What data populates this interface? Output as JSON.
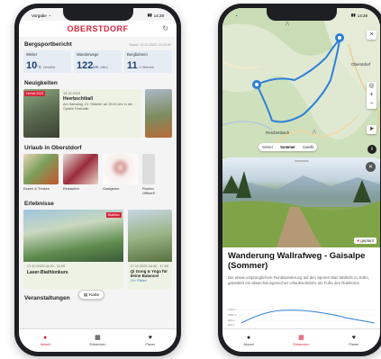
{
  "left": {
    "status_left": "Vorgabe",
    "status_right": "14:28",
    "brand": "OBERSTDORF",
    "refresh_icon": "refresh-icon",
    "report": {
      "title": "Bergsportbericht",
      "timestamp": "Stand: 13.10.2023 13:43:30",
      "cards": [
        {
          "label": "Wetter",
          "value": "10",
          "unit": "°C",
          "sub": "bewölkt"
        },
        {
          "label": "Wanderwege",
          "value": "122",
          "unit": "km",
          "sub": "offen"
        },
        {
          "label": "Bergbahnen",
          "value": "11",
          "unit": "",
          "sub": "in Betrieb"
        }
      ]
    },
    "news": {
      "title": "Neuigkeiten",
      "tag": "Herbst 2023",
      "date": "13.10.2023",
      "headline": "Heerbschtball",
      "text": "Am Samstag, 21. Oktober ab 19:00 Uhr in der Oybele Festhalle."
    },
    "urlaub": {
      "title": "Urlaub in Oberstdorf",
      "items": [
        "Essen & Trinken",
        "Einkaufen",
        "Gastgeber",
        "Routen"
      ],
      "peek_sub": "OfflineS"
    },
    "events": {
      "title": "Erlebnisse",
      "card": {
        "tag": "Biathlon",
        "date": "17.10.2023 10:00 - 11:00",
        "title": "Laser-Biathlonkurs"
      },
      "peek": {
        "date": "17.10.2023 16:00 - 17:00",
        "title": "Qi Gong & Yoga für deine Balance!",
        "link": "10+ Plätze"
      }
    },
    "next_section": "Veranstaltungen",
    "karte": "Karte",
    "tabs": [
      {
        "label": "Aktuell",
        "icon": "home-icon",
        "glyph": "●"
      },
      {
        "label": "Entdecken",
        "icon": "grid-icon",
        "glyph": "▦"
      },
      {
        "label": "Planer",
        "icon": "heart-icon",
        "glyph": "♥"
      }
    ]
  },
  "right": {
    "status_right": "14:28",
    "map_labels": {
      "town": "Oberstdorf",
      "start": "Reichenbach"
    },
    "map_types": [
      "Winter",
      "Sommer",
      "Satellit"
    ],
    "active_map_type": "Sommer",
    "controls": [
      "×",
      "◎",
      "+",
      "−",
      "➤"
    ],
    "info": "i",
    "planned": "geplant",
    "title": "Wanderung Wallrafweg - Gaisalpe (Sommer)",
    "description": "Die etwas ursprünglichere Rundwanderung auf den Spuren Max Wallrafs zu Kühn, garantiert ein abwechslungsreiches Urlaubserlebnis am Fuße des Rubihorns.",
    "elevation_ticks": [
      "1100 m",
      "1000 m",
      "900 m",
      "800 m"
    ],
    "tabs": [
      {
        "label": "Aktuell",
        "icon": "home-icon",
        "glyph": "●"
      },
      {
        "label": "Entdecken",
        "icon": "grid-icon",
        "glyph": "▦"
      },
      {
        "label": "Planer",
        "icon": "heart-icon",
        "glyph": "♥"
      }
    ],
    "active_tab": "Entdecken"
  }
}
